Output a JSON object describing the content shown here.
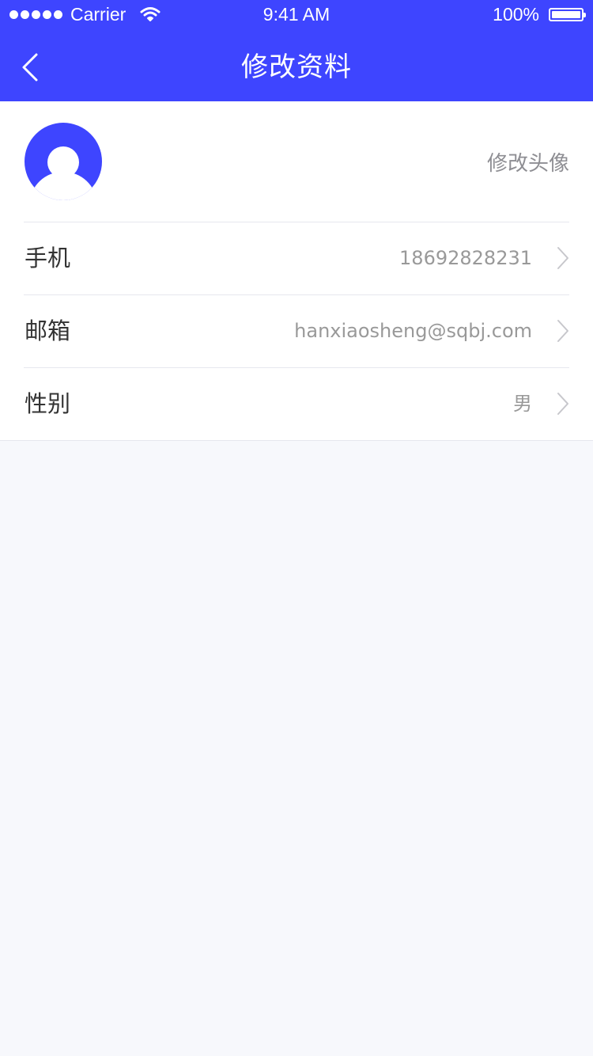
{
  "status_bar": {
    "carrier": "Carrier",
    "time": "9:41 AM",
    "battery": "100%"
  },
  "nav": {
    "title": "修改资料",
    "back_icon": "chevron-left-icon"
  },
  "profile": {
    "avatar_icon": "user-avatar-icon",
    "change_avatar_label": "修改头像",
    "rows": [
      {
        "label": "手机",
        "value": "18692828231"
      },
      {
        "label": "邮箱",
        "value": "hanxiaosheng@sqbj.com"
      },
      {
        "label": "性别",
        "value": "男"
      }
    ]
  },
  "colors": {
    "primary": "#3e45ff",
    "background": "#f7f8fc",
    "card": "#ffffff",
    "text_primary": "#333333",
    "text_secondary": "#999999"
  }
}
